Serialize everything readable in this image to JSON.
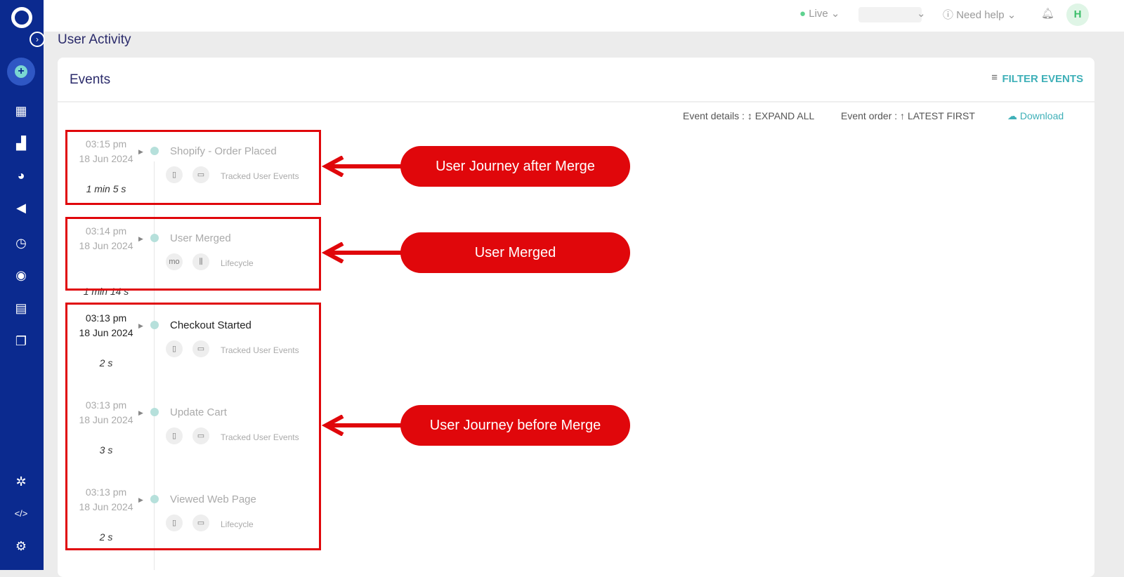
{
  "sidebar": {
    "expand_icon": "chevron-right-circle",
    "items": [
      "dashboard",
      "analytics",
      "segments",
      "campaigns",
      "flows",
      "users",
      "content",
      "templates"
    ],
    "bottom": [
      "integrations",
      "developer",
      "settings"
    ]
  },
  "topbar": {
    "env": "Live",
    "help": "Need help",
    "avatar": "H"
  },
  "page": {
    "title": "User Activity"
  },
  "card": {
    "title": "Events",
    "filter": "FILTER EVENTS",
    "event_details_label": "Event details :",
    "expand_all": "EXPAND ALL",
    "event_order_label": "Event order :",
    "latest_first": "LATEST FIRST",
    "download": "Download"
  },
  "events": [
    {
      "time": "03:15 pm",
      "date": "18 Jun 2024",
      "duration": "1 min 5 s",
      "title": "Shopify - Order Placed",
      "category": "Tracked User Events",
      "chip": ""
    },
    {
      "time": "03:14 pm",
      "date": "18 Jun 2024",
      "duration": "1 min 14 s",
      "title": "User Merged",
      "category": "Lifecycle",
      "chip": "mo"
    },
    {
      "time": "03:13 pm",
      "date": "18 Jun 2024",
      "duration": "2 s",
      "title": "Checkout Started",
      "category": "Tracked User Events",
      "chip": ""
    },
    {
      "time": "03:13 pm",
      "date": "18 Jun 2024",
      "duration": "3 s",
      "title": "Update Cart",
      "category": "Tracked User Events",
      "chip": ""
    },
    {
      "time": "03:13 pm",
      "date": "18 Jun 2024",
      "duration": "2 s",
      "title": "Viewed Web Page",
      "category": "Lifecycle",
      "chip": ""
    }
  ],
  "annotations": [
    "User Journey after Merge",
    "User Merged",
    "User Journey before Merge"
  ],
  "colors": {
    "sidebar": "#0b2a8f",
    "accent": "#3fb0b8",
    "annotation": "#e0070b"
  }
}
